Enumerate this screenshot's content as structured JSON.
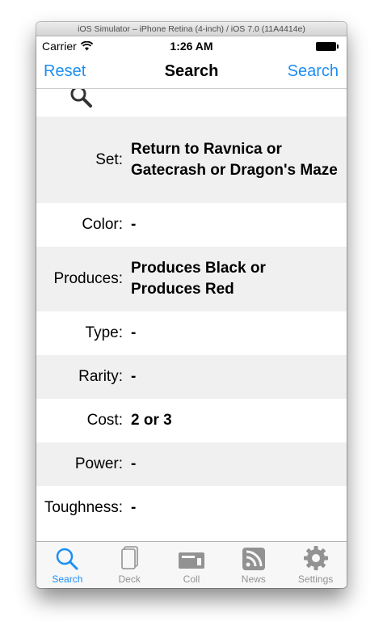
{
  "window": {
    "title": "iOS Simulator – iPhone Retina (4-inch) / iOS 7.0 (11A4414e)"
  },
  "status_bar": {
    "carrier": "Carrier",
    "time": "1:26 AM"
  },
  "nav": {
    "left": "Reset",
    "title": "Search",
    "right": "Search"
  },
  "rows": [
    {
      "label": "Set:",
      "value": "Return to Ravnica or Gatecrash or Dragon's Maze"
    },
    {
      "label": "Color:",
      "value": "-"
    },
    {
      "label": "Produces:",
      "value": "Produces Black or Produces Red"
    },
    {
      "label": "Type:",
      "value": "-"
    },
    {
      "label": "Rarity:",
      "value": "-"
    },
    {
      "label": "Cost:",
      "value": "2 or 3"
    },
    {
      "label": "Power:",
      "value": "-"
    },
    {
      "label": "Toughness:",
      "value": "-"
    }
  ],
  "tabs": [
    {
      "label": "Search",
      "icon": "search-icon",
      "active": true
    },
    {
      "label": "Deck",
      "icon": "deck-icon",
      "active": false
    },
    {
      "label": "Coll",
      "icon": "collection-icon",
      "active": false
    },
    {
      "label": "News",
      "icon": "rss-icon",
      "active": false
    },
    {
      "label": "Settings",
      "icon": "gear-icon",
      "active": false
    }
  ],
  "colors": {
    "accent": "#1c8ef3",
    "inactive_tab": "#929292",
    "row_alt": "#f0f0f0"
  }
}
